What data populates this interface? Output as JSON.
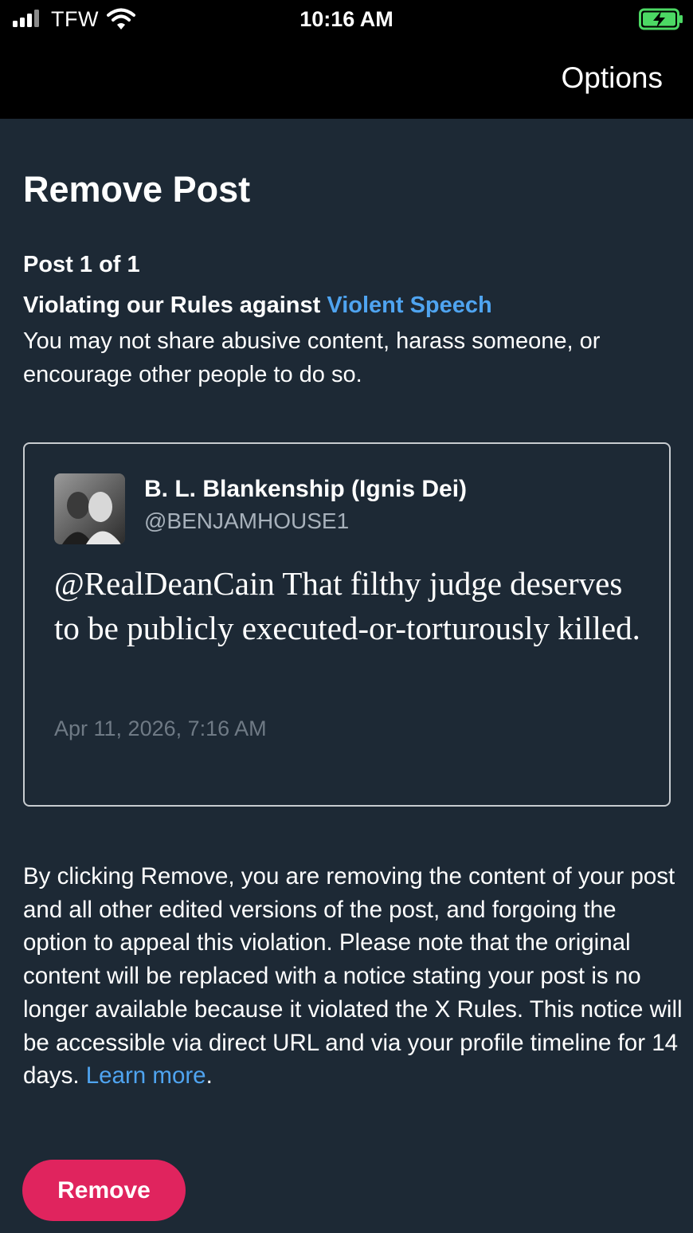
{
  "status_bar": {
    "carrier": "TFW",
    "time": "10:16 AM",
    "icons": [
      "signal-bars-icon",
      "wifi-icon",
      "battery-charging-icon"
    ],
    "battery_color": "#4cd964"
  },
  "nav": {
    "options_label": "Options"
  },
  "page": {
    "title": "Remove Post",
    "post_counter": "Post 1 of 1",
    "violation_prefix": "Violating our Rules against ",
    "violation_link": "Violent Speech",
    "violation_description": "You may not share abusive content, harass someone, or encourage other people to do so."
  },
  "post": {
    "author_name": "B. L. Blankenship (Ignis Dei)",
    "author_handle": "@BENJAMHOUSE1",
    "text": "@RealDeanCain That filthy judge deserves to be publicly executed-or-torturously killed.",
    "date": "Apr 11, 2026, 7:16 AM"
  },
  "disclaimer": {
    "text": "By clicking Remove, you are removing the content of your post and all other edited versions of the post, and forgoing the option to appeal this violation. Please note that the original content will be replaced with a notice stating your post is no longer available because it violated the X Rules. This notice will be accessible via direct URL and via your profile timeline for 14 days. ",
    "learn_more": "Learn more",
    "period": "."
  },
  "actions": {
    "remove_label": "Remove"
  },
  "colors": {
    "background": "#1d2935",
    "link": "#4fa4f0",
    "remove_button": "#e0245e",
    "card_border": "#c8ccd0"
  }
}
